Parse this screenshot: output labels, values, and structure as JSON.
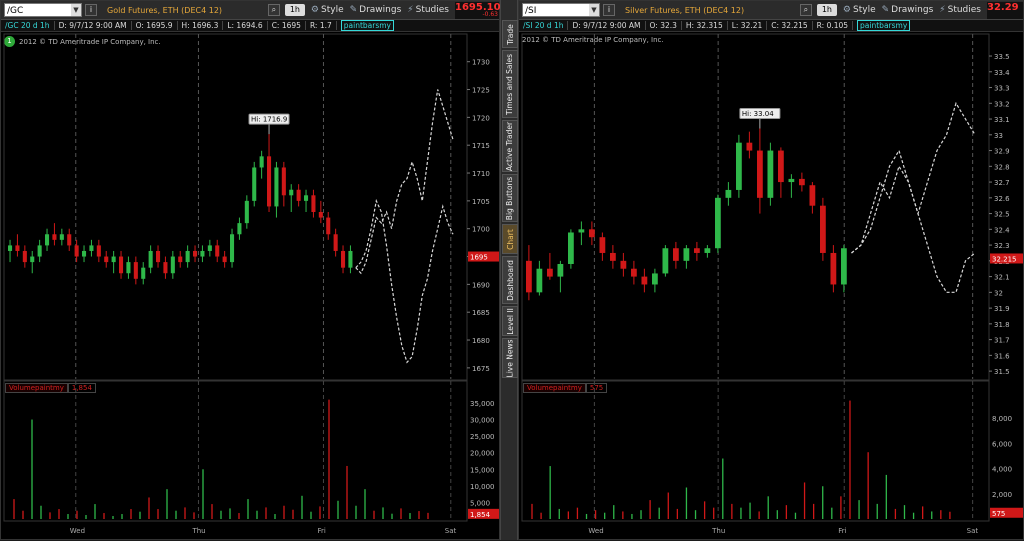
{
  "panes": [
    {
      "id": "gold",
      "symbol": "/GC",
      "symbol_name": "Gold Futures, ETH (DEC4 12)",
      "aggregation": "1h",
      "last_price": "1695.10",
      "change": "-0.63",
      "ohlc": {
        "sym": "/GC 20 d 1h",
        "date": "D: 9/7/12 9:00 AM",
        "open": "O: 1695.9",
        "high": "H: 1696.3",
        "low": "L: 1694.6",
        "close": "C: 1695",
        "range": "R: 1.7",
        "study": "paintbarsmy"
      },
      "copyright": "2012 © TD Ameritrade IP Company, Inc.",
      "hi_label": "Hi: 1716.9",
      "price_axis": [
        "1730",
        "1725",
        "1720",
        "1715",
        "1710",
        "1705",
        "1700",
        "1695",
        "1690",
        "1685",
        "1680",
        "1675"
      ],
      "price_range": [
        1673,
        1733
      ],
      "current_price_label": "1695",
      "volume_label": "Volumepaintmy",
      "volume_value": "1,854",
      "volume_axis": [
        "35,000",
        "30,000",
        "25,000",
        "20,000",
        "15,000",
        "10,000",
        "5,000"
      ],
      "volume_range": [
        0,
        38000
      ],
      "time_axis": [
        "Wed",
        "Thu",
        "Fri",
        "Sat"
      ]
    },
    {
      "id": "silver",
      "symbol": "/SI",
      "symbol_name": "Silver Futures, ETH (DEC4 12)",
      "aggregation": "1h",
      "last_price": "32.29",
      "change": "",
      "ohlc": {
        "sym": "/SI 20 d 1h",
        "date": "D: 9/7/12 9:00 AM",
        "open": "O: 32.3",
        "high": "H: 32.315",
        "low": "L: 32.21",
        "close": "C: 32.215",
        "range": "R: 0.105",
        "study": "paintbarsmy"
      },
      "copyright": "2012 © TD Ameritrade IP Company, Inc.",
      "hi_label": "Hi: 33.04",
      "price_axis": [
        "33.5",
        "33.4",
        "33.3",
        "33.2",
        "33.1",
        "33",
        "32.9",
        "32.8",
        "32.7",
        "32.6",
        "32.5",
        "32.4",
        "32.3",
        "32.2",
        "32.1",
        "32",
        "31.9",
        "31.8",
        "31.7",
        "31.6",
        "31.5"
      ],
      "price_range": [
        31.45,
        33.57
      ],
      "current_price_label": "32.215",
      "volume_label": "Volumepaintmy",
      "volume_value": "575",
      "volume_axis": [
        "8,000",
        "6,000",
        "4,000",
        "2,000"
      ],
      "volume_range": [
        0,
        10000
      ],
      "time_axis": [
        "Wed",
        "Thu",
        "Fri",
        "Sat"
      ]
    }
  ],
  "toolbar": {
    "style_label": "Style",
    "drawings_label": "Drawings",
    "studies_label": "Studies"
  },
  "side_tabs": [
    "Trade",
    "Times and Sales",
    "Active Trader",
    "Big Buttons",
    "Chart",
    "Dashboard",
    "Level II",
    "Live News"
  ],
  "colors": {
    "up": "#2fb84a",
    "down": "#d01818",
    "ghost": "#d8d8d8",
    "background": "#000000",
    "price_badge": "#d01818"
  },
  "chart_data": [
    {
      "type": "candlestick",
      "series_label": "/GC 20 d 1h",
      "y_range": [
        1673,
        1733
      ],
      "ohlc_bars": [
        [
          1696,
          1698,
          1694,
          1697
        ],
        [
          1697,
          1699,
          1695,
          1696
        ],
        [
          1696,
          1697,
          1693,
          1694
        ],
        [
          1694,
          1696,
          1692,
          1695
        ],
        [
          1695,
          1698,
          1694,
          1697
        ],
        [
          1697,
          1700,
          1696,
          1699
        ],
        [
          1699,
          1701,
          1697,
          1698
        ],
        [
          1698,
          1700,
          1697,
          1699
        ],
        [
          1699,
          1700,
          1696,
          1697
        ],
        [
          1697,
          1698,
          1694,
          1695
        ],
        [
          1695,
          1697,
          1694,
          1696
        ],
        [
          1696,
          1698,
          1695,
          1697
        ],
        [
          1697,
          1698,
          1694,
          1695
        ],
        [
          1695,
          1696,
          1693,
          1694
        ],
        [
          1694,
          1696,
          1692,
          1695
        ],
        [
          1695,
          1696,
          1691,
          1692
        ],
        [
          1692,
          1695,
          1691,
          1694
        ],
        [
          1694,
          1695,
          1690,
          1691
        ],
        [
          1691,
          1694,
          1690,
          1693
        ],
        [
          1693,
          1697,
          1692,
          1696
        ],
        [
          1696,
          1697,
          1693,
          1694
        ],
        [
          1694,
          1695,
          1691,
          1692
        ],
        [
          1692,
          1696,
          1691,
          1695
        ],
        [
          1695,
          1696,
          1693,
          1694
        ],
        [
          1694,
          1697,
          1693,
          1696
        ],
        [
          1696,
          1697,
          1694,
          1695
        ],
        [
          1695,
          1697,
          1694,
          1696
        ],
        [
          1696,
          1698,
          1695,
          1697
        ],
        [
          1697,
          1698,
          1694,
          1695
        ],
        [
          1695,
          1696,
          1693,
          1694
        ],
        [
          1694,
          1700,
          1693,
          1699
        ],
        [
          1699,
          1702,
          1698,
          1701
        ],
        [
          1701,
          1706,
          1700,
          1705
        ],
        [
          1705,
          1712,
          1704,
          1711
        ],
        [
          1711,
          1714,
          1709,
          1713
        ],
        [
          1713,
          1717,
          1703,
          1704
        ],
        [
          1704,
          1712,
          1702,
          1711
        ],
        [
          1711,
          1712,
          1704,
          1706
        ],
        [
          1706,
          1708,
          1703,
          1707
        ],
        [
          1707,
          1708,
          1704,
          1705
        ],
        [
          1705,
          1707,
          1703,
          1706
        ],
        [
          1706,
          1707,
          1702,
          1703
        ],
        [
          1703,
          1705,
          1701,
          1702
        ],
        [
          1702,
          1703,
          1698,
          1699
        ],
        [
          1699,
          1700,
          1695,
          1696
        ],
        [
          1696,
          1697,
          1692,
          1693
        ],
        [
          1693,
          1697,
          1692,
          1696
        ]
      ],
      "ghost_projections": [
        [
          1693,
          1692,
          1694,
          1698,
          1702,
          1701,
          1703,
          1700,
          1705,
          1708,
          1709,
          1712,
          1709,
          1705,
          1712,
          1719,
          1725,
          1722,
          1719,
          1716
        ],
        [
          1693,
          1694,
          1696,
          1700,
          1705,
          1703,
          1697,
          1690,
          1684,
          1679,
          1676,
          1677,
          1682,
          1688,
          1691,
          1696,
          1700,
          1704,
          1701,
          1699
        ]
      ],
      "volume": [
        6000,
        2500,
        30000,
        4000,
        2000,
        3000,
        1500,
        2500,
        1200,
        4500,
        1800,
        900,
        1500,
        3000,
        2200,
        6500,
        3000,
        9000,
        2500,
        3500,
        2000,
        15000,
        4500,
        2500,
        3200,
        1800,
        6000,
        2500,
        3500,
        1500,
        4000,
        2800,
        7000,
        2200,
        3800,
        36000,
        5500,
        16000,
        4000,
        9000,
        2500,
        3500,
        1600,
        3200,
        1800,
        2400,
        1854
      ]
    },
    {
      "type": "candlestick",
      "series_label": "/SI 20 d 1h",
      "y_range": [
        31.45,
        33.57
      ],
      "ohlc_bars": [
        [
          32.2,
          32.3,
          31.95,
          32.0
        ],
        [
          32.0,
          32.2,
          31.98,
          32.15
        ],
        [
          32.15,
          32.25,
          32.08,
          32.1
        ],
        [
          32.1,
          32.2,
          32.0,
          32.18
        ],
        [
          32.18,
          32.4,
          32.15,
          32.38
        ],
        [
          32.38,
          32.45,
          32.3,
          32.4
        ],
        [
          32.4,
          32.45,
          32.3,
          32.35
        ],
        [
          32.35,
          32.38,
          32.2,
          32.25
        ],
        [
          32.25,
          32.3,
          32.15,
          32.2
        ],
        [
          32.2,
          32.25,
          32.1,
          32.15
        ],
        [
          32.15,
          32.2,
          32.05,
          32.1
        ],
        [
          32.1,
          32.15,
          32.0,
          32.05
        ],
        [
          32.05,
          32.15,
          32.0,
          32.12
        ],
        [
          32.12,
          32.3,
          32.1,
          32.28
        ],
        [
          32.28,
          32.32,
          32.15,
          32.2
        ],
        [
          32.2,
          32.3,
          32.15,
          32.28
        ],
        [
          32.28,
          32.32,
          32.2,
          32.25
        ],
        [
          32.25,
          32.3,
          32.22,
          32.28
        ],
        [
          32.28,
          32.62,
          32.25,
          32.6
        ],
        [
          32.6,
          32.7,
          32.55,
          32.65
        ],
        [
          32.65,
          33.0,
          32.6,
          32.95
        ],
        [
          32.95,
          33.02,
          32.85,
          32.9
        ],
        [
          32.9,
          33.04,
          32.5,
          32.6
        ],
        [
          32.6,
          32.95,
          32.55,
          32.9
        ],
        [
          32.9,
          32.92,
          32.6,
          32.7
        ],
        [
          32.7,
          32.75,
          32.6,
          32.72
        ],
        [
          32.72,
          32.76,
          32.64,
          32.68
        ],
        [
          32.68,
          32.7,
          32.5,
          32.55
        ],
        [
          32.55,
          32.6,
          32.2,
          32.25
        ],
        [
          32.25,
          32.3,
          32.0,
          32.05
        ],
        [
          32.05,
          32.3,
          32.0,
          32.28
        ]
      ],
      "ghost_projections": [
        [
          32.25,
          32.3,
          32.5,
          32.7,
          32.6,
          32.8,
          32.7,
          32.5,
          32.7,
          32.9,
          33.0,
          33.2,
          33.1,
          33.0
        ],
        [
          32.25,
          32.3,
          32.4,
          32.6,
          32.8,
          32.9,
          32.7,
          32.5,
          32.3,
          32.1,
          32.0,
          32.0,
          32.2,
          32.25
        ]
      ],
      "volume": [
        1200,
        500,
        4200,
        800,
        600,
        900,
        400,
        700,
        500,
        1100,
        600,
        400,
        700,
        1500,
        900,
        2100,
        800,
        2500,
        700,
        1400,
        900,
        4800,
        1200,
        900,
        1300,
        600,
        1800,
        700,
        1100,
        500,
        2900,
        1200,
        2600,
        900,
        1800,
        9400,
        1500,
        5300,
        1200,
        3500,
        800,
        1100,
        500,
        1000,
        600,
        700,
        575
      ]
    }
  ]
}
